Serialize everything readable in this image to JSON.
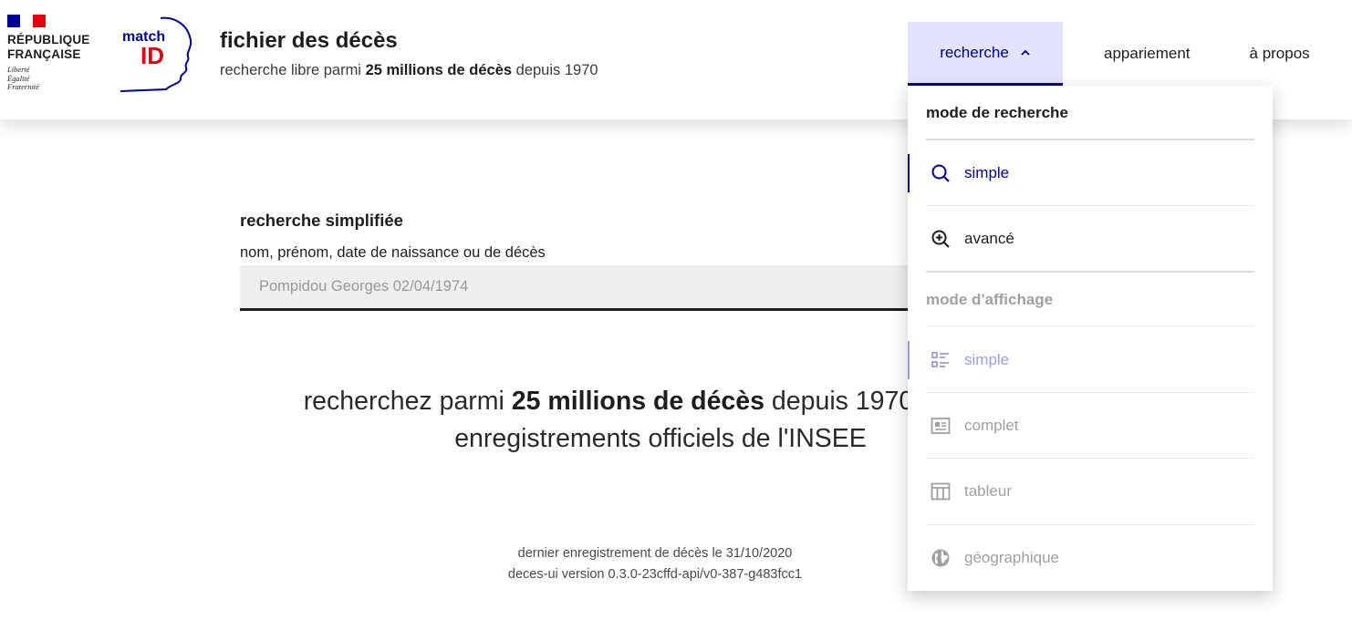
{
  "brand": {
    "flag_colors": [
      "#000091",
      "#ffffff",
      "#e1000f"
    ],
    "republic_line1": "RÉPUBLIQUE",
    "republic_line2": "FRANÇAISE",
    "motto": [
      "Liberté",
      "Égalité",
      "Fraternité"
    ],
    "logo_text_match": "match",
    "logo_text_id": "ID"
  },
  "site": {
    "title": "fichier des décès",
    "desc_prefix": "recherche libre parmi ",
    "desc_bold": "25 millions de décès",
    "desc_suffix": " depuis 1970"
  },
  "nav": {
    "recherche": "recherche",
    "appariement": "appariement",
    "apropos": "à propos"
  },
  "search": {
    "title": "recherche simplifiée",
    "label": "nom, prénom, date de naissance ou de décès",
    "placeholder": "Pompidou Georges 02/04/1974",
    "value": ""
  },
  "hero": {
    "prefix": "recherchez parmi ",
    "bold": "25 millions de décès",
    "suffix": " depuis 1970 dans les enregistrements officiels de l'INSEE"
  },
  "footer": {
    "line1": "dernier enregistrement de décès le 31/10/2020",
    "line2": "deces-ui version 0.3.0-23cffd-api/v0-387-g483fcc1"
  },
  "dropdown": {
    "section_search_mode": "mode de recherche",
    "search_items": [
      {
        "label": "simple",
        "icon": "search-icon",
        "active": true
      },
      {
        "label": "avancé",
        "icon": "zoom-in-icon",
        "active": false
      }
    ],
    "section_display_mode": "mode d'affichage",
    "display_items": [
      {
        "label": "simple",
        "icon": "list-icon",
        "active": true
      },
      {
        "label": "complet",
        "icon": "card-icon",
        "active": false
      },
      {
        "label": "tableur",
        "icon": "table-icon",
        "active": false
      },
      {
        "label": "géographique",
        "icon": "globe-icon",
        "active": false
      }
    ]
  },
  "colors": {
    "accent": "#000091",
    "accent_light": "#e3e3fd",
    "disabled_text": "#a0a0a0",
    "disabled_accent": "#9c9cdb"
  }
}
